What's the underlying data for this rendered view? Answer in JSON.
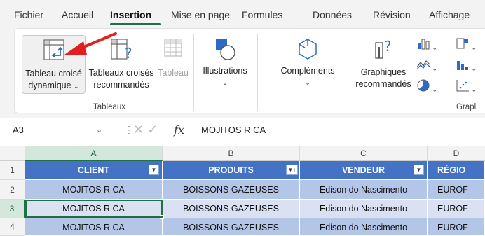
{
  "ribbon_tabs": [
    {
      "label": "Fichier"
    },
    {
      "label": "Accueil"
    },
    {
      "label": "Insertion",
      "active": true
    },
    {
      "label": "Mise en page"
    },
    {
      "label": "Formules"
    },
    {
      "label": "Données"
    },
    {
      "label": "Révision"
    },
    {
      "label": "Affichage"
    }
  ],
  "tableaux_group": {
    "label": "Tableaux",
    "pivot_table": {
      "line1": "Tableau croisé",
      "line2": "dynamique",
      "caret": "⌄",
      "icon": "pivot-table-icon"
    },
    "recommended_pivot": {
      "line1": "Tableaux croisés",
      "line2": "recommandés",
      "icon": "recommended-pivot-icon"
    },
    "table": {
      "label": "Tableau",
      "icon": "table-icon"
    }
  },
  "illustrations": {
    "label": "Illustrations",
    "caret": "⌄",
    "icon": "shapes-icon"
  },
  "complements": {
    "label": "Compléments",
    "caret": "⌄",
    "icon": "addins-icon"
  },
  "charts": {
    "line1": "Graphiques",
    "line2": "recommandés",
    "icon": "recommended-charts-icon",
    "group_label_partial": "Grapl"
  },
  "arrow_color": "#e02020",
  "formula_bar": {
    "name_box": "A3",
    "name_caret": "⌄",
    "separator": "⋮",
    "cancel_enter": "✕ ✓",
    "fx": "fx",
    "value": "MOJITOS R CA"
  },
  "sheet": {
    "columns": [
      "A",
      "B",
      "C",
      "D"
    ],
    "rows": [
      "1",
      "2",
      "3",
      "4"
    ],
    "headers": [
      "CLIENT",
      "PRODUITS",
      "VENDEUR",
      "RÉGIO"
    ],
    "filter_glyphs": [
      "▼",
      "▼↑",
      "▼",
      ""
    ],
    "data": [
      [
        "MOJITOS R CA",
        "BOISSONS GAZEUSES",
        "Edison do Nascimento",
        "EUROF"
      ],
      [
        "MOJITOS R CA",
        "BOISSONS GAZEUSES",
        "Edison do Nascimento",
        "EUROF"
      ],
      [
        "MOJITOS R CA",
        "BOISSONS GAZEUSES",
        "Edison do Nascimento",
        "EUROF"
      ]
    ],
    "header_color": "#4472c4",
    "band_color": "#b4c6e7",
    "band_alt_color": "#d9e1f2",
    "selection_color": "#1e7145"
  }
}
